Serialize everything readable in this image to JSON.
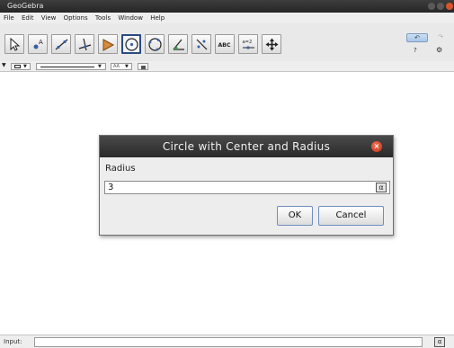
{
  "window": {
    "title": "GeoGebra"
  },
  "menu": [
    "File",
    "Edit",
    "View",
    "Options",
    "Tools",
    "Window",
    "Help"
  ],
  "toolbar": {
    "tools": [
      {
        "icon": "move-arrow-icon"
      },
      {
        "icon": "point-icon"
      },
      {
        "icon": "line-icon"
      },
      {
        "icon": "perpendicular-line-icon"
      },
      {
        "icon": "polygon-icon"
      },
      {
        "icon": "circle-center-radius-icon",
        "active": true
      },
      {
        "icon": "circle-three-points-icon"
      },
      {
        "icon": "angle-icon"
      },
      {
        "icon": "reflect-icon"
      },
      {
        "icon": "text-icon",
        "text": "ABC"
      },
      {
        "icon": "slider-icon",
        "text": "a=2"
      },
      {
        "icon": "move-graphics-view-icon"
      }
    ],
    "undo_icon": "undo-icon",
    "redo_icon": "redo-icon",
    "help_text": "?",
    "settings_icon": "gear-icon"
  },
  "stylebar": {
    "items": [
      "point-style-icon",
      "line-style-icon",
      "label-style-icon",
      "lock-icon"
    ]
  },
  "dialog": {
    "title": "Circle with Center and Radius",
    "label": "Radius",
    "value": "3",
    "alpha_symbol": "α",
    "ok_label": "OK",
    "cancel_label": "Cancel"
  },
  "input_bar": {
    "label": "Input:",
    "alpha_symbol": "α"
  },
  "colors": {
    "titlebar": "#2e2e2e",
    "close": "#d9542b",
    "active_border": "#2b4a80"
  }
}
